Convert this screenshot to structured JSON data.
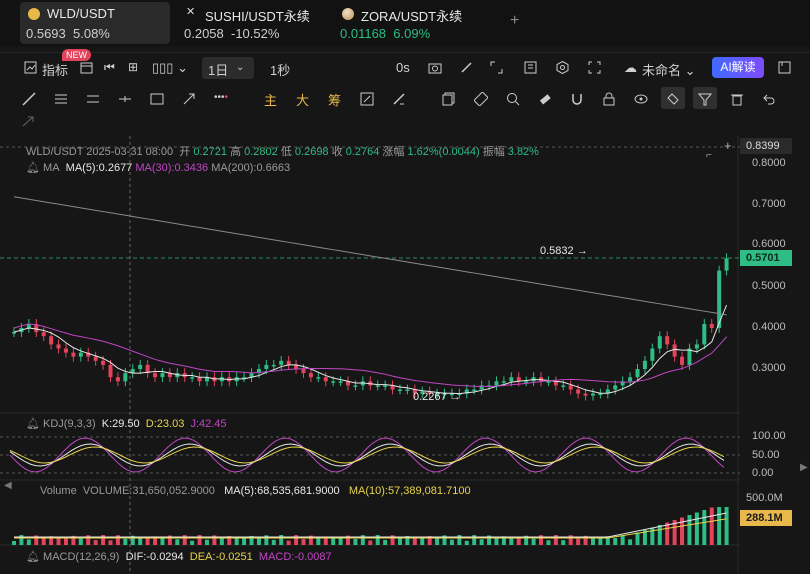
{
  "tabs": [
    {
      "symbol": "WLD/USDT",
      "price": "0.5693",
      "change": "5.08%",
      "change_color": "#e8e8e8",
      "icon_color": "#e8b84a"
    },
    {
      "symbol": "SUSHI/USDT永续",
      "price": "0.2058",
      "change": "-10.52%",
      "change_color": "#e8e8e8",
      "icon_color": "#dddddd"
    },
    {
      "symbol": "ZORA/USDT永续",
      "price": "0.01168",
      "change": "6.09%",
      "change_color": "#2ebd85",
      "icon_color": "#e8c899"
    }
  ],
  "add_tab": "+",
  "toolbar": {
    "indicators": "指标",
    "new_badge": "NEW",
    "interval": "1日",
    "sub_interval": "1秒",
    "countdown": "0s",
    "layout_name": "未命名",
    "ai_label": "AI解读"
  },
  "drawing_tools": {
    "main": "主",
    "big": "大",
    "chip": "筹"
  },
  "chart": {
    "title": "WLD/USDT  2025-03-31 08:00",
    "ohlc": [
      {
        "k": "开",
        "v": "0.2721"
      },
      {
        "k": "高",
        "v": "0.2802"
      },
      {
        "k": "低",
        "v": "0.2698"
      },
      {
        "k": "收",
        "v": "0.2764"
      },
      {
        "k": "涨幅",
        "v": "1.62%(0.0044)"
      },
      {
        "k": "振幅",
        "v": "3.82%"
      }
    ],
    "ma_label": "MA",
    "ma5": "MA(5):0.2677",
    "ma30": "MA(30):0.3436",
    "ma200": "MA(200):0.6663",
    "y_ticks": [
      "0.8399",
      "0.8000",
      "0.7000",
      "0.6000",
      "0.5000",
      "0.4000",
      "0.3000"
    ],
    "current_price": "0.5701",
    "high_mark": "0.5832 →",
    "low_mark": "0.2267 →",
    "colors": {
      "up": "#2ebd85",
      "down": "#e2455b",
      "ma5": "#e8e8e8",
      "ma30": "#c046c6",
      "ma200": "#8a8a8a"
    }
  },
  "kdj": {
    "label": "KDJ(9,3,3)",
    "k": "K:29.50",
    "d": "D:23.03",
    "j": "J:42.45",
    "ticks": [
      "100.00",
      "50.00",
      "0.00"
    ]
  },
  "volume": {
    "label": "Volume",
    "vol": "VOLUME:31,650,052.9000",
    "ma5": "MA(5):68,535,681.9000",
    "ma10": "MA(10):57,389,081.7100",
    "ticks": [
      "500.0M"
    ],
    "current": "288.1M"
  },
  "macd": {
    "label": "MACD(12,26,9)",
    "dif": "DIF:-0.0294",
    "dea": "DEA:-0.0251",
    "macd": "MACD:-0.0087"
  }
}
